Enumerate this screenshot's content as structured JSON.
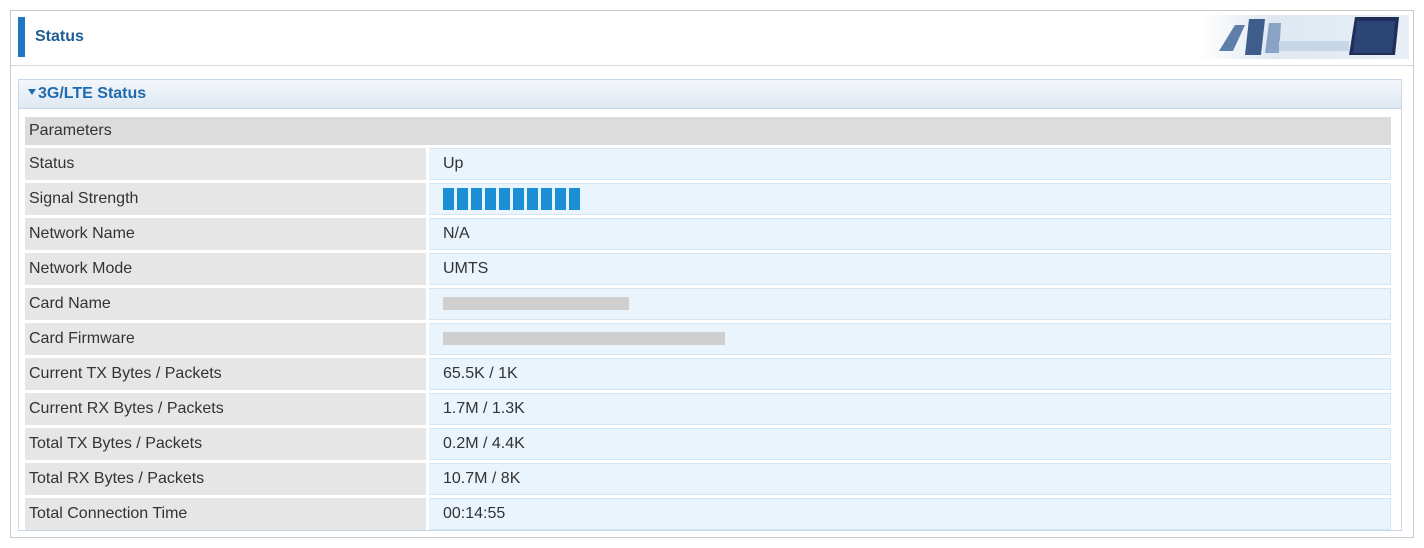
{
  "header": {
    "title": "Status"
  },
  "section": {
    "label": "3G/LTE Status"
  },
  "table": {
    "header": "Parameters",
    "rows": [
      {
        "key": "Status",
        "value": "Up"
      },
      {
        "key": "Signal Strength",
        "signal_bars": 10
      },
      {
        "key": "Network Name",
        "value": "N/A"
      },
      {
        "key": "Network Mode",
        "value": "UMTS"
      },
      {
        "key": "Card Name",
        "redacted": true
      },
      {
        "key": "Card Firmware",
        "redacted": true
      },
      {
        "key": "Current TX Bytes / Packets",
        "value": "65.5K / 1K"
      },
      {
        "key": "Current RX Bytes / Packets",
        "value": "1.7M / 1.3K"
      },
      {
        "key": "Total TX Bytes / Packets",
        "value": "0.2M / 4.4K"
      },
      {
        "key": "Total RX Bytes / Packets",
        "value": "10.7M / 8K"
      },
      {
        "key": "Total Connection Time",
        "value": "00:14:55"
      }
    ]
  },
  "colors": {
    "accent": "#1f77c4",
    "title": "#1e5e95",
    "signal": "#1a8fd6",
    "value_cell": "#eaf4fc"
  }
}
